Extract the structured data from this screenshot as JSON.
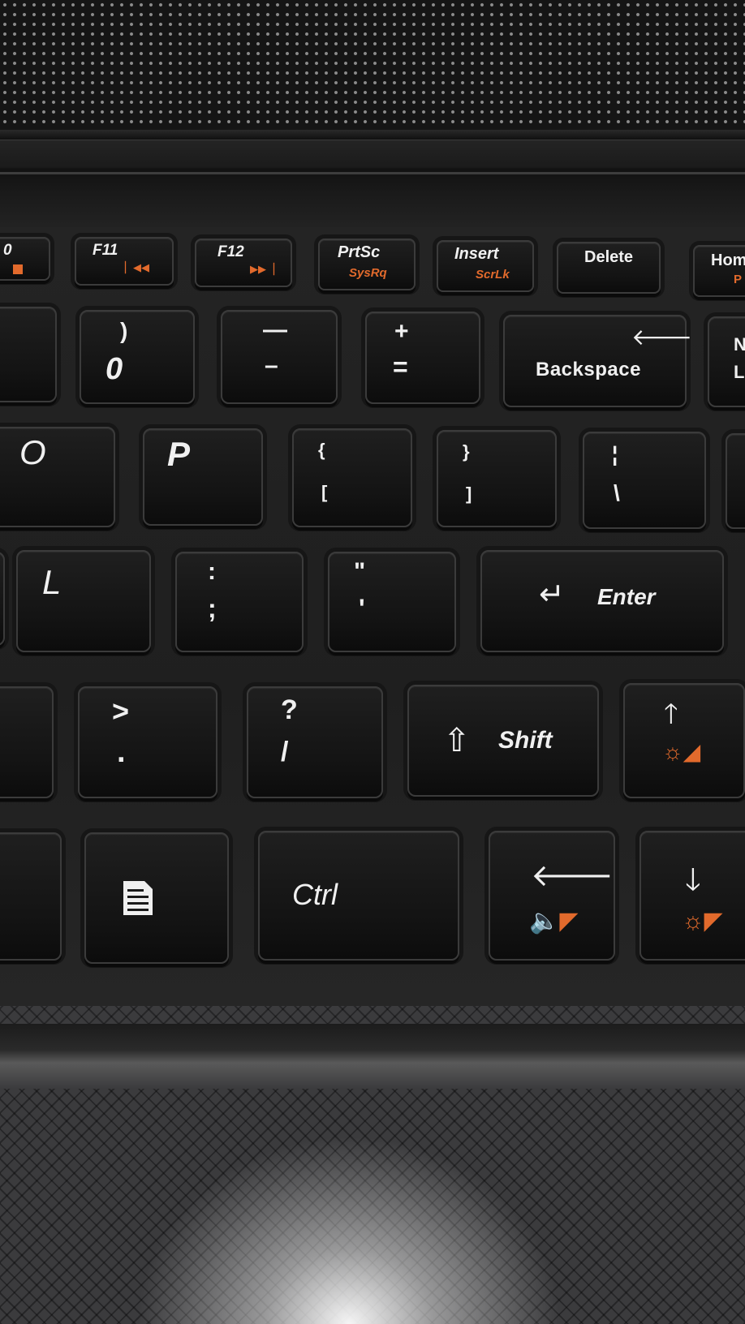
{
  "fkeys": {
    "f10": "0",
    "f11": "F11",
    "f12": "F12",
    "prtsc": "PrtSc",
    "sysrq": "SysRq",
    "insert": "Insert",
    "scrlk": "ScrLk",
    "delete": "Delete",
    "home": "Hom",
    "pgup": "P"
  },
  "row_numbers": {
    "zero_top": ")",
    "zero_bottom": "0",
    "minus_top": "—",
    "minus_bottom": "–",
    "plus_top": "+",
    "plus_bottom": "=",
    "backspace": "Backspace",
    "edge_top": "N",
    "edge_bottom": "L"
  },
  "row_top": {
    "o": "O",
    "p": "P",
    "lbrace_top": "{",
    "lbrace_bottom": "[",
    "rbrace_top": "}",
    "rbrace_bottom": "]",
    "pipe_top": "¦",
    "pipe_bottom": "\\"
  },
  "row_home": {
    "l": "L",
    "colon_top": ":",
    "colon_bottom": ";",
    "quote_top": "\"",
    "quote_bottom": "'",
    "enter": "Enter"
  },
  "row_shift": {
    "period_top": ">",
    "period_bottom": ".",
    "slash_top": "?",
    "slash_bottom": "/",
    "shift": "Shift"
  },
  "row_bottom": {
    "ctrl": "Ctrl"
  },
  "colors": {
    "legend": "#f0f0f0",
    "fn_accent": "#e26a2c",
    "keycap": "#151515",
    "palmrest": "#3b3b3d"
  }
}
